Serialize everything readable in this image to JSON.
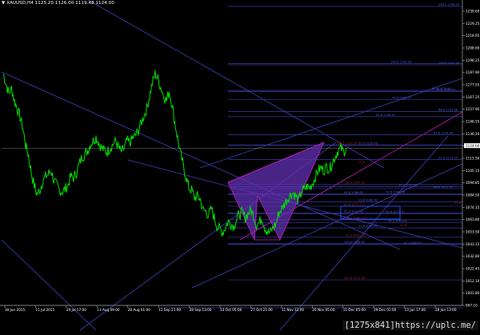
{
  "symbol_header": {
    "arrow": "▼",
    "text": "XAUUSD,H4  1125.20  1126.00  1119.48  1124.00"
  },
  "colors": {
    "background": "#000000",
    "price_line": "#00e000",
    "channel": "#4040c0",
    "fib_level": "#3a3aa8",
    "fib_label": "#5060e0",
    "pattern_fill": "#6030b0",
    "pattern_edge": "#c020c0",
    "ext_label": "#b02020",
    "axis_text": "#ffffff",
    "target_box": "#2050ff"
  },
  "chart_data": {
    "type": "line",
    "title": "XAUUSD,H4",
    "y_ticks": [
      "1239.60",
      "1229.25",
      "1218.95",
      "1208.60",
      "1198.25",
      "1187.90",
      "1177.55",
      "1167.25",
      "1157.90",
      "1146.55",
      "1136.20",
      "1124.00",
      "1115.50",
      "1105.15",
      "1094.85",
      "1084.50",
      "1074.15",
      "1063.80",
      "1053.50",
      "1043.15",
      "1032.80",
      "1022.45",
      "1012.10",
      "1001.80",
      "997.10"
    ],
    "x_ticks": [
      "30 Jun 2015",
      "15 Jul 2015",
      "29 Jul 17:00",
      "13 Aug 09:00",
      "28 Aug 01:00",
      "11 Sep 21:00",
      "28 Sep 13:00",
      "13 Oct 05:00",
      "27 Oct 21:00",
      "11 Nov 13:00",
      "26 Nov 05:00",
      "11 Dec 05:00",
      "29 Dec 01:00",
      "13 Jan 17:00",
      "28 Jan 13:00"
    ],
    "ylim": [
      997.1,
      1239.6
    ],
    "current_price": "1124.00",
    "close_series": [
      1184,
      1176,
      1168,
      1172,
      1162,
      1156,
      1149,
      1140,
      1126,
      1118,
      1104,
      1094,
      1087,
      1090,
      1097,
      1101,
      1103,
      1106,
      1098,
      1094,
      1090,
      1089,
      1091,
      1094,
      1101,
      1100,
      1104,
      1111,
      1117,
      1119,
      1122,
      1127,
      1130,
      1133,
      1128,
      1124,
      1122,
      1121,
      1124,
      1127,
      1130,
      1124,
      1121,
      1124,
      1130,
      1128,
      1132,
      1134,
      1138,
      1144,
      1150,
      1156,
      1166,
      1176,
      1184,
      1180,
      1173,
      1167,
      1162,
      1170,
      1160,
      1145,
      1132,
      1120,
      1110,
      1100,
      1092,
      1090,
      1084,
      1085,
      1083,
      1074,
      1073,
      1070,
      1075,
      1068,
      1061,
      1059,
      1056,
      1060,
      1065,
      1063,
      1061,
      1067,
      1071,
      1072,
      1068,
      1071,
      1074,
      1070,
      1062,
      1064,
      1068,
      1060,
      1056,
      1056,
      1060,
      1063,
      1072,
      1075,
      1079,
      1083,
      1086,
      1088,
      1085,
      1082,
      1088,
      1091,
      1093,
      1092,
      1096,
      1101,
      1106,
      1108,
      1106,
      1109,
      1107,
      1112,
      1117,
      1122,
      1124,
      1121,
      1124
    ],
    "fib_labels": [
      {
        "text": "138.2  1238.29",
        "price": 1238.3
      },
      {
        "text": "100.0  1192.33",
        "price": 1192.3
      },
      {
        "text": "100.0  1191.15",
        "price": 1191.2
      },
      {
        "text": "88.6  1170.47",
        "price": 1170.5
      },
      {
        "text": "78.6  1169.67",
        "price": 1169.7
      },
      {
        "text": "78.6  1163.27",
        "price": 1163.3
      },
      {
        "text": "88.6  1153.36",
        "price": 1153.4
      },
      {
        "text": "61.8  1149.40",
        "price": 1149.4
      },
      {
        "text": "61.8  1134.96",
        "price": 1134.9
      },
      {
        "text": "50.0  1126.46",
        "price": 1126.5
      },
      {
        "text": "138.2  1126.29",
        "price": 1126.3
      },
      {
        "text": "50.0  1114.79",
        "price": 1114.8
      },
      {
        "text": "38.2  1094.70",
        "price": 1094.7
      },
      {
        "text": "88.6  1091.35",
        "price": 1091.3
      },
      {
        "text": "61.8  1086.60",
        "price": 1086.6
      },
      {
        "text": "78.6  1087.16",
        "price": 1087.2
      },
      {
        "text": "38.2  1092.81",
        "price": 1092.8
      },
      {
        "text": "23.6  1080.62",
        "price": 1080.6
      },
      {
        "text": "61.8  1077.11",
        "price": 1077.1
      },
      {
        "text": "50.0  1071.17",
        "price": 1071.2
      },
      {
        "text": "50.0  1071.62",
        "price": 1071.6
      },
      {
        "text": "38.2  1066.23",
        "price": 1066.2
      },
      {
        "text": "38.2  1063.82",
        "price": 1063.8
      },
      {
        "text": "23.6  1059.60",
        "price": 1059.6
      },
      {
        "text": "23.6  1052.24",
        "price": 1052.2
      },
      {
        "text": "0.0  1046.23",
        "price": 1046.2
      },
      {
        "text": "100.0  1046.95",
        "price": 1046.9
      },
      {
        "text": "161.8  1017.66",
        "price": 1017.7
      }
    ],
    "small_tags": [
      "23.6",
      "23.6",
      "23.6"
    ]
  },
  "footer": {
    "text": "[1275x841]https://uplc.me/"
  }
}
